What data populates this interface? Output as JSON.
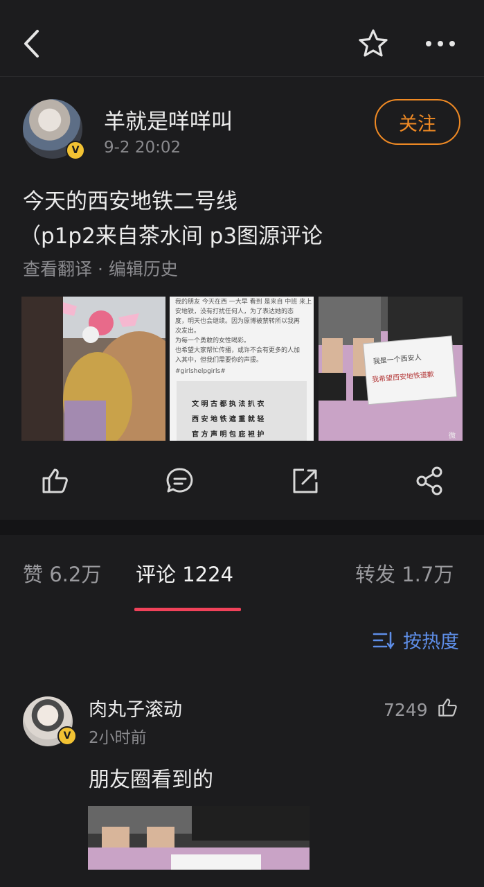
{
  "nav": {
    "back_icon": "chevron-left-icon",
    "star_icon": "star-icon",
    "more_icon": "more-icon"
  },
  "post": {
    "author": "羊就是咩咩叫",
    "time": "9-2 20:02",
    "follow_label": "关注",
    "verified_badge": "V",
    "text_line1": "今天的西安地铁二号线",
    "text_line2": "（p1p2来自茶水间 p3图源评论",
    "sub_links": "查看翻译 · 编辑历史",
    "image2_text_lines": [
      "我的朋友 今天在西 一大早 看到 是来自 中班 来上 的",
      "安地铁，没有打扰任何人，为了表达她的态",
      "度，明天也会继续。因为原博被禁转所以我再",
      "次发出。",
      "为每一个勇敢的女性喝彩。",
      "也希望大家帮忙传播，或许不会有更多的人加",
      "入其中，但我们需要你的声援。",
      "#girlshelpgirls#"
    ],
    "image2_sign_rows": [
      "文 明 古 都 执 法 扒 衣",
      "西 安 地 铁 遮 重 就 轻",
      "官 方 声 明 包 庇 袒 护"
    ],
    "image3_sign_line1": "我是一个西安人",
    "image3_sign_line2": "我希望西安地铁道歉",
    "watermark": "微"
  },
  "actions": [
    "thumbs-up-icon",
    "comment-icon",
    "repost-icon",
    "share-icon"
  ],
  "tabs": {
    "likes": "赞 6.2万",
    "comments": "评论 1224",
    "reposts": "转发 1.7万"
  },
  "sort": {
    "icon": "sort-icon",
    "label": "按热度"
  },
  "comment": {
    "author": "肉丸子滚动",
    "time": "2小时前",
    "likes": "7249",
    "text": "朋友圈看到的",
    "verified_badge": "V"
  },
  "colors": {
    "background": "#1c1c1e",
    "accent_orange": "#f08a24",
    "tab_underline": "#f0425a",
    "link_blue": "#5e8ee8",
    "badge_gold": "#f2c233"
  }
}
